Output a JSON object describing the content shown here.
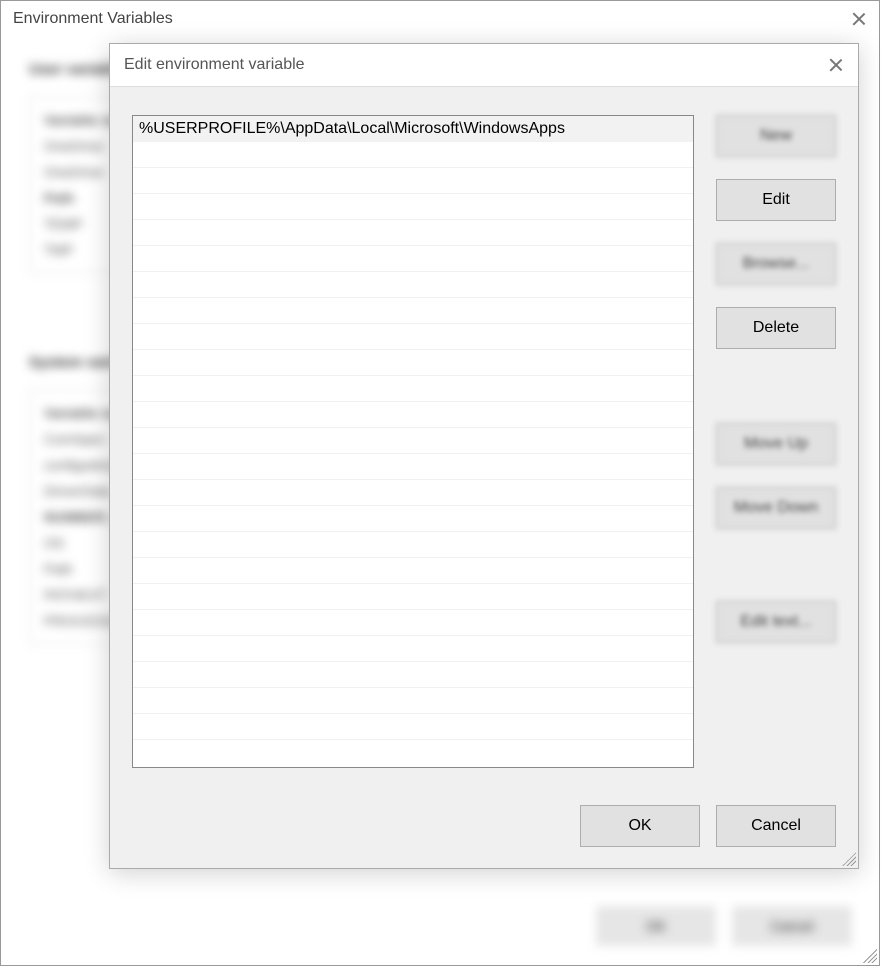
{
  "bg": {
    "title": "Environment Variables",
    "user_label": "User variables",
    "user_rows": [
      "Variable name",
      "OneDrive",
      "OneDrive",
      "Path",
      "TEMP",
      "TMP"
    ],
    "system_label": "System variables",
    "system_rows": [
      "Variable name",
      "ComSpec",
      "configsetroot",
      "DriverData",
      "NUMBER_OF",
      "OS",
      "Path",
      "PATHEXT",
      "PROCESSOR"
    ],
    "ok": "OK",
    "cancel": "Cancel"
  },
  "dialog": {
    "title": "Edit environment variable",
    "entries": [
      "%USERPROFILE%\\AppData\\Local\\Microsoft\\WindowsApps"
    ],
    "buttons": {
      "new": "New",
      "edit": "Edit",
      "browse": "Browse...",
      "delete": "Delete",
      "move_up": "Move Up",
      "move_down": "Move Down",
      "edit_text": "Edit text...",
      "ok": "OK",
      "cancel": "Cancel"
    }
  }
}
